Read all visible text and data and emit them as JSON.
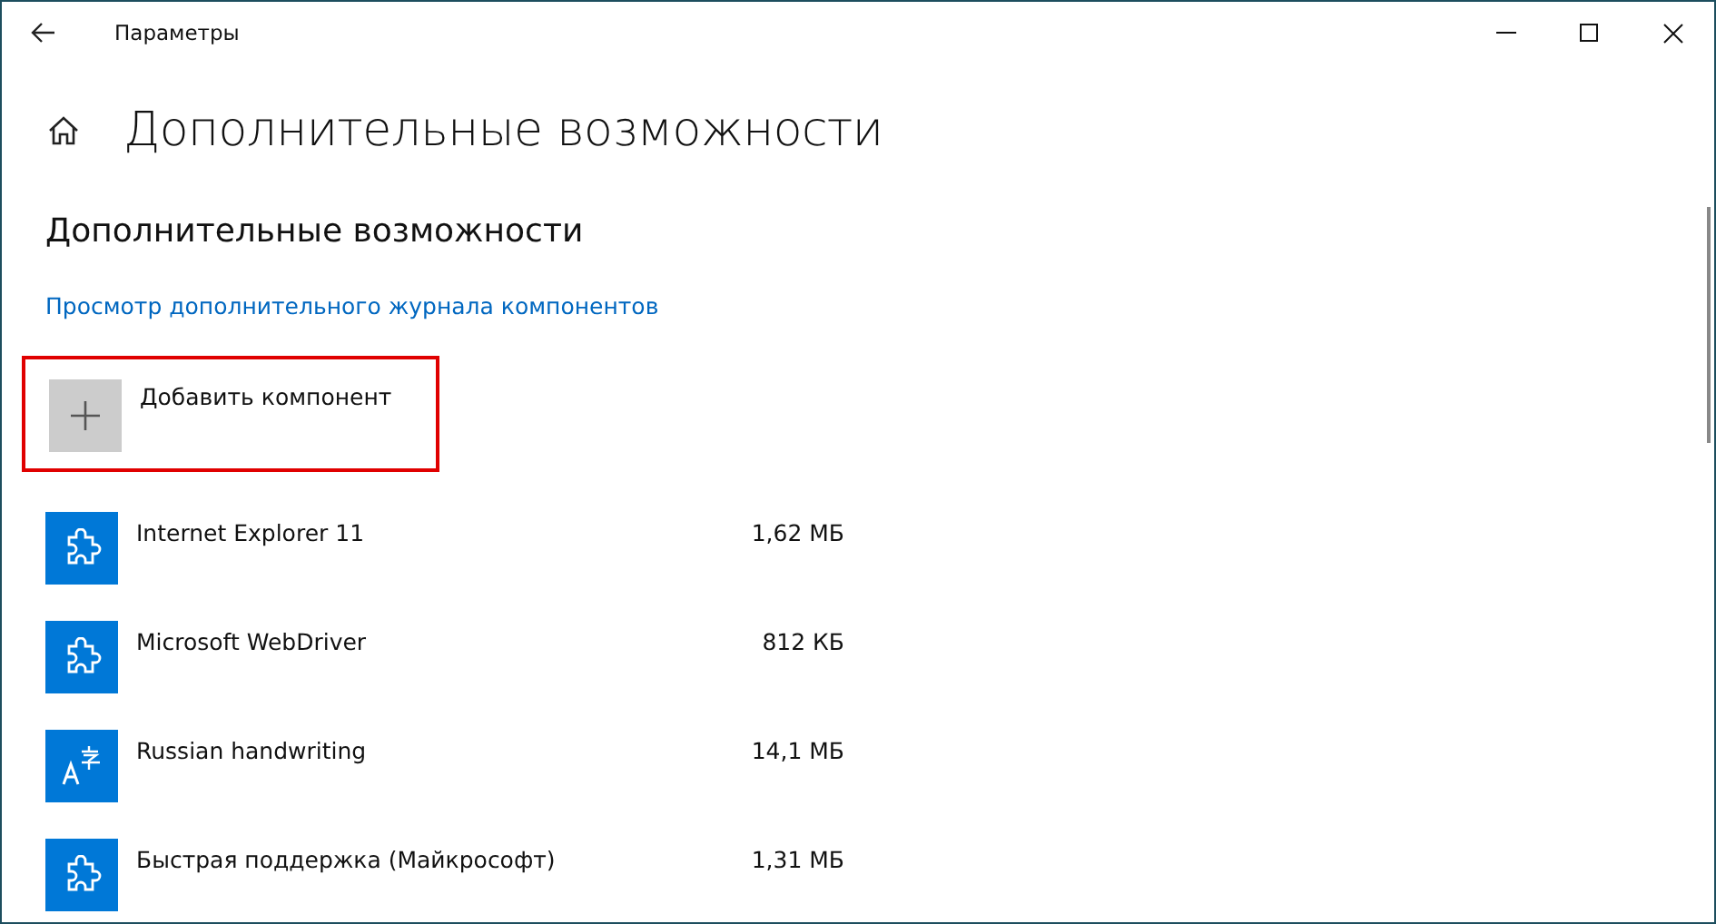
{
  "window": {
    "title": "Параметры"
  },
  "page_title": "Дополнительные возможности",
  "section_title": "Дополнительные возможности",
  "history_link": "Просмотр дополнительного журнала компонентов",
  "add_button": {
    "label": "Добавить компонент",
    "highlighted": true
  },
  "features": [
    {
      "kind": "puzzle",
      "name": "Internet Explorer 11",
      "size": "1,62 МБ"
    },
    {
      "kind": "puzzle",
      "name": "Microsoft WebDriver",
      "size": "812 КБ"
    },
    {
      "kind": "language",
      "name": "Russian handwriting",
      "size": "14,1 МБ"
    },
    {
      "kind": "puzzle",
      "name": "Быстрая поддержка (Майкрософт)",
      "size": "1,31 МБ"
    }
  ]
}
